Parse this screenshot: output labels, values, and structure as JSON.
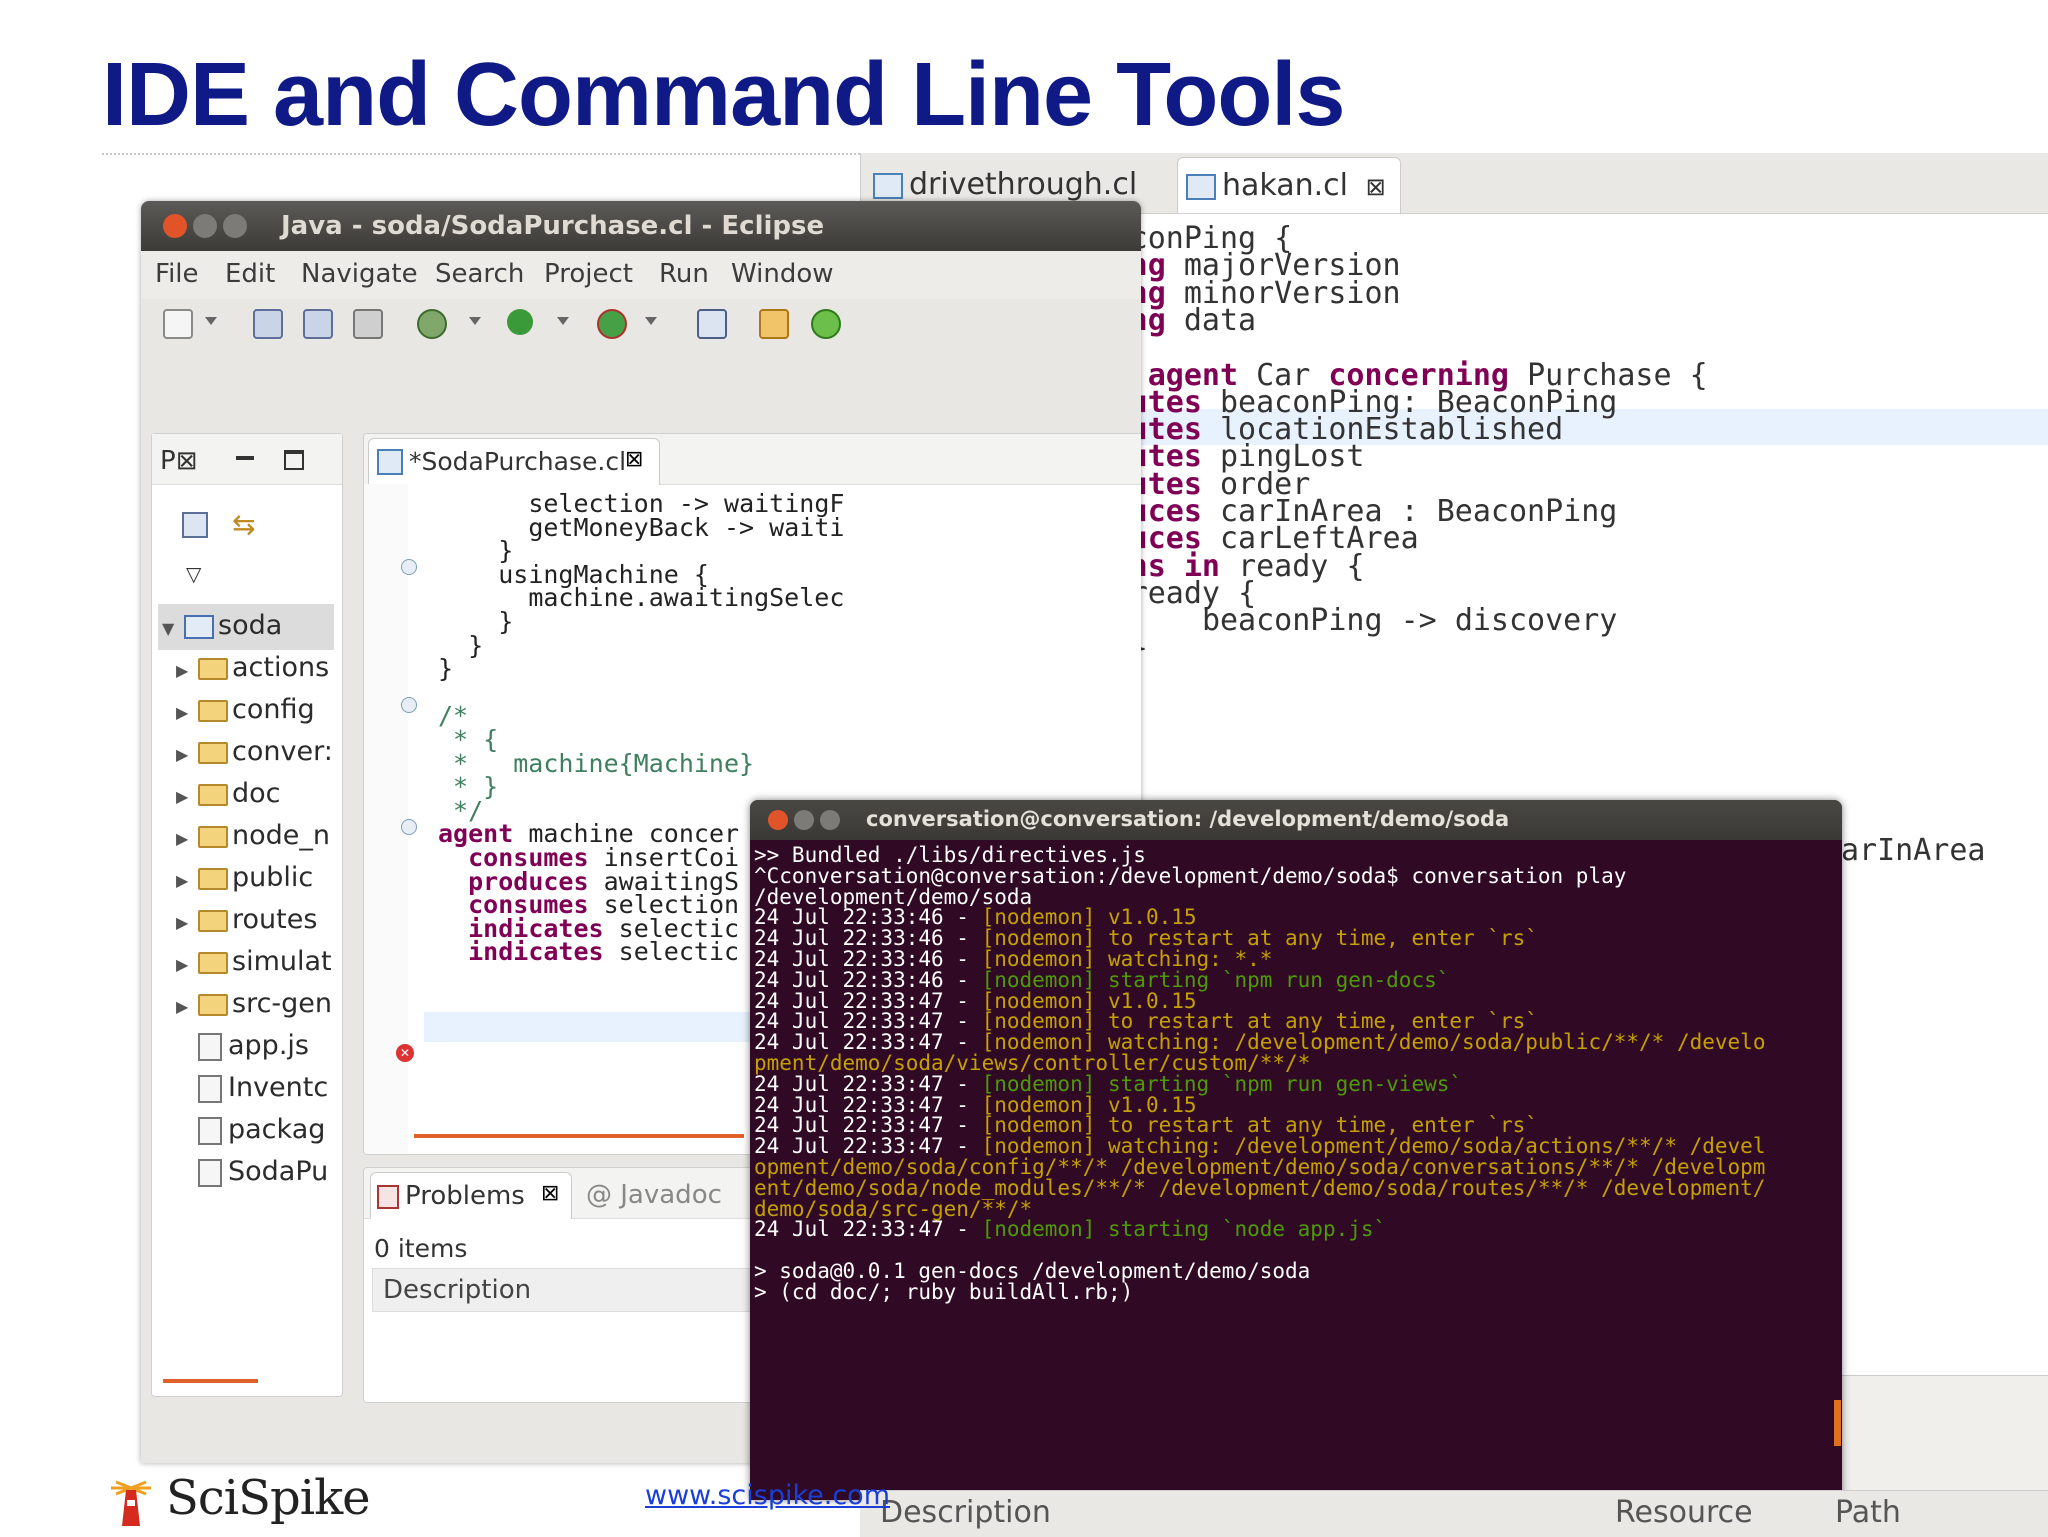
{
  "slide": {
    "title": "IDE and Command Line Tools",
    "footer_link": "www.scispike.com",
    "logo_text": "SciSpike"
  },
  "eclipse": {
    "window_title": "Java - soda/SodaPurchase.cl - Eclipse",
    "menu": [
      "File",
      "Edit",
      "Navigate",
      "Search",
      "Project",
      "Run",
      "Window"
    ],
    "package_explorer": {
      "tab_label": "P",
      "root": "soda",
      "items": [
        "actions",
        "config",
        "conver:",
        "doc",
        "node_n",
        "public",
        "routes",
        "simulat",
        "src-gen",
        "app.js",
        "Inventc",
        "packag",
        "SodaPu"
      ]
    },
    "editor": {
      "tab_label": "*SodaPurchase.cl",
      "lines": [
        "      selection -> waitingF",
        "      getMoneyBack -> waiti",
        "    }",
        "    usingMachine {",
        "      machine.awaitingSelec",
        "    }",
        "  }",
        "}",
        "",
        "/*",
        " * {",
        " *   machine{Machine}",
        " * }",
        " */",
        "agent machine concer",
        "  consumes insertCoi",
        "  produces awaitingS",
        "  consumes selection",
        "  indicates selectic",
        "  indicates selectic"
      ]
    },
    "problems": {
      "tab_label": "Problems",
      "tab2_label": "Javadoc",
      "count": "0 items",
      "column": "Description"
    }
  },
  "right_editor": {
    "tabs": [
      "drivethrough.cl",
      "hakan.cl"
    ],
    "lines": [
      "   type BeaconPing {",
      "       String majorVersion",
      "       String minorVersion",
      "       String data",
      "   }",
      "   infinite agent Car concerning Purchase {",
      "       executes beaconPing: BeaconPing",
      "       executes locationEstablished",
      "       executes pingLost",
      "       executes order",
      "       produces carInArea : BeaconPing",
      "       produces carLeftArea",
      "       begins in ready {",
      "           ready {",
      "               beaconPing -> discovery",
      "           }"
    ],
    "overflow_text": "arInArea",
    "status_columns": [
      "Description",
      "Resource",
      "Path"
    ]
  },
  "terminal": {
    "title": "conversation@conversation: /development/demo/soda",
    "lines": [
      ">> Bundled ./libs/directives.js",
      "^Cconversation@conversation:/development/demo/soda$ conversation play",
      "/development/demo/soda",
      "24 Jul 22:33:46 - [nodemon] v1.0.15",
      "24 Jul 22:33:46 - [nodemon] to restart at any time, enter `rs`",
      "24 Jul 22:33:46 - [nodemon] watching: *.*",
      "24 Jul 22:33:46 - [nodemon] starting `npm run gen-docs`",
      "24 Jul 22:33:47 - [nodemon] v1.0.15",
      "24 Jul 22:33:47 - [nodemon] to restart at any time, enter `rs`",
      "24 Jul 22:33:47 - [nodemon] watching: /development/demo/soda/public/**/* /develo",
      "pment/demo/soda/views/controller/custom/**/*",
      "24 Jul 22:33:47 - [nodemon] starting `npm run gen-views`",
      "24 Jul 22:33:47 - [nodemon] v1.0.15",
      "24 Jul 22:33:47 - [nodemon] to restart at any time, enter `rs`",
      "24 Jul 22:33:47 - [nodemon] watching: /development/demo/soda/actions/**/* /devel",
      "opment/demo/soda/config/**/* /development/demo/soda/conversations/**/* /developm",
      "ent/demo/soda/node_modules/**/* /development/demo/soda/routes/**/* /development/",
      "demo/soda/src-gen/**/*",
      "24 Jul 22:33:47 - [nodemon] starting `node app.js`",
      "",
      "> soda@0.0.1 gen-docs /development/demo/soda",
      "> (cd doc/; ruby buildAll.rb;)"
    ]
  },
  "colors": {
    "title_blue": "#0f1a86",
    "terminal_bg": "#300a24",
    "keyword": "#7f0055",
    "nodemon_yellow": "#c4a000",
    "nodemon_green": "#4e9a06"
  }
}
